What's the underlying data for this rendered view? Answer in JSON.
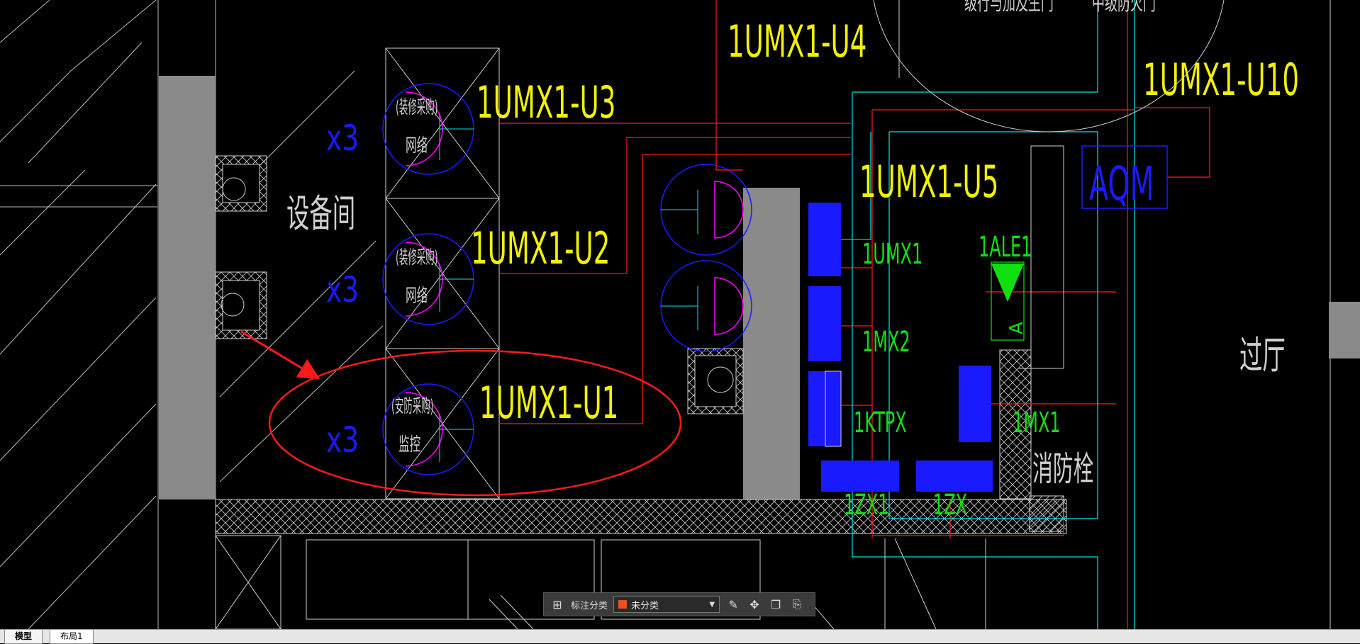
{
  "drawing": {
    "room_labels": {
      "equipment_room": "设备间",
      "hallway": "过厅",
      "fire_hydrant": "消防栓"
    },
    "rack_labels": [
      "1UMX1-U3",
      "1UMX1-U2",
      "1UMX1-U1",
      "1UMX1-U4",
      "1UMX1-U5",
      "1UMX1-U10"
    ],
    "multiplier_labels": [
      "x3",
      "x3",
      "x3"
    ],
    "outlet_labels": {
      "decor_network_1": "(装修采购)",
      "network_1": "网络",
      "decor_network_2": "(装修采购)",
      "network_2": "网络",
      "security_1": "(安防采购)",
      "monitor_1": "监控"
    },
    "panel_labels": {
      "umx1": "1UMX1",
      "mx2": "1MX2",
      "ktpx": "1KTPX",
      "zx1": "1ZX1",
      "zx": "1ZX",
      "ale1": "1ALE1",
      "mx1": "1MX1",
      "aqm": "AQM",
      "ale_letter": "A"
    },
    "top_labels": {
      "left": "级行与加及生门",
      "right": "中级防火门"
    }
  },
  "toolbar": {
    "label": "标注分类",
    "select_value": "未分类",
    "select_color": "#e8521e"
  },
  "tabs": {
    "model": "模型",
    "layout1": "布局1"
  },
  "colors": {
    "yellow": "#f2f200",
    "green": "#10e010",
    "blue": "#1a1aff",
    "magenta": "#ff00ff",
    "cyan": "#00e5e5",
    "red": "#ff1a1a",
    "gray": "#8a8a8a",
    "white": "#d8d8d8"
  }
}
